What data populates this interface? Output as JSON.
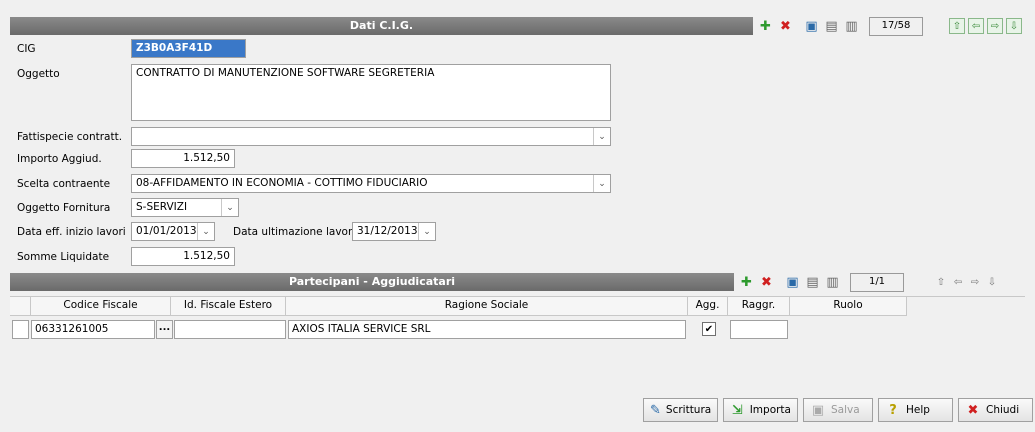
{
  "cig_section": {
    "title": "Dati C.I.G.",
    "counter": "17/58",
    "fields": {
      "cig_label": "CIG",
      "cig_value": "Z3B0A3F41D",
      "oggetto_label": "Oggetto",
      "oggetto_value": "CONTRATTO DI MANUTENZIONE SOFTWARE SEGRETERIA",
      "fattispecie_label": "Fattispecie contratt.",
      "fattispecie_value": "",
      "importo_label": "Importo Aggiud.",
      "importo_value": "1.512,50",
      "scelta_label": "Scelta contraente",
      "scelta_value": "08-AFFIDAMENTO IN ECONOMIA - COTTIMO FIDUCIARIO",
      "fornitura_label": "Oggetto Fornitura",
      "fornitura_value": "S-SERVIZI",
      "data_inizio_label": "Data eff. inizio lavori",
      "data_inizio_value": "01/01/2013",
      "data_fine_label": "Data ultimazione lavori",
      "data_fine_value": "31/12/2013",
      "somme_label": "Somme Liquidate",
      "somme_value": "1.512,50"
    }
  },
  "partecipanti": {
    "title": "Partecipani - Aggiudicatari",
    "counter": "1/1",
    "columns": [
      "Codice Fiscale",
      "Id. Fiscale Estero",
      "Ragione Sociale",
      "Agg.",
      "Raggr.",
      "Ruolo"
    ],
    "rows": [
      {
        "codice_fiscale": "06331261005",
        "lookup": "...",
        "id_estero": "",
        "ragione_sociale": "AXIOS ITALIA SERVICE SRL",
        "agg_checked": "✔",
        "raggr": "",
        "ruolo": ""
      }
    ]
  },
  "footer": {
    "scrittura": "Scrittura",
    "importa": "Importa",
    "salva": "Salva",
    "help": "Help",
    "chiudi": "Chiudi"
  },
  "colors": {
    "add": "#2e9a2e",
    "delete": "#d02020",
    "nav": "#3a8a3a"
  }
}
